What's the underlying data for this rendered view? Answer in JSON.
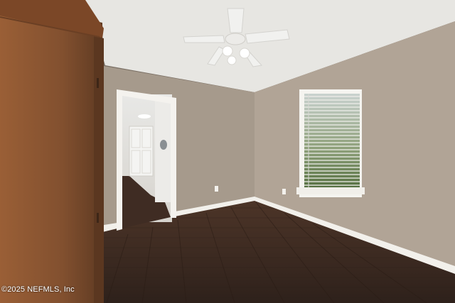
{
  "watermark": {
    "text": "©2025 NEFMLS, Inc"
  },
  "colors": {
    "ceiling": "#e9e8e4",
    "wall_left": "#a99c8e",
    "wall_right": "#b3a698",
    "floor_dark": "#3b2a22",
    "floor_light": "#5a4032",
    "trim": "#f3f1ec",
    "armoire": "#8a5330",
    "window_view": "#5e7a4a"
  }
}
